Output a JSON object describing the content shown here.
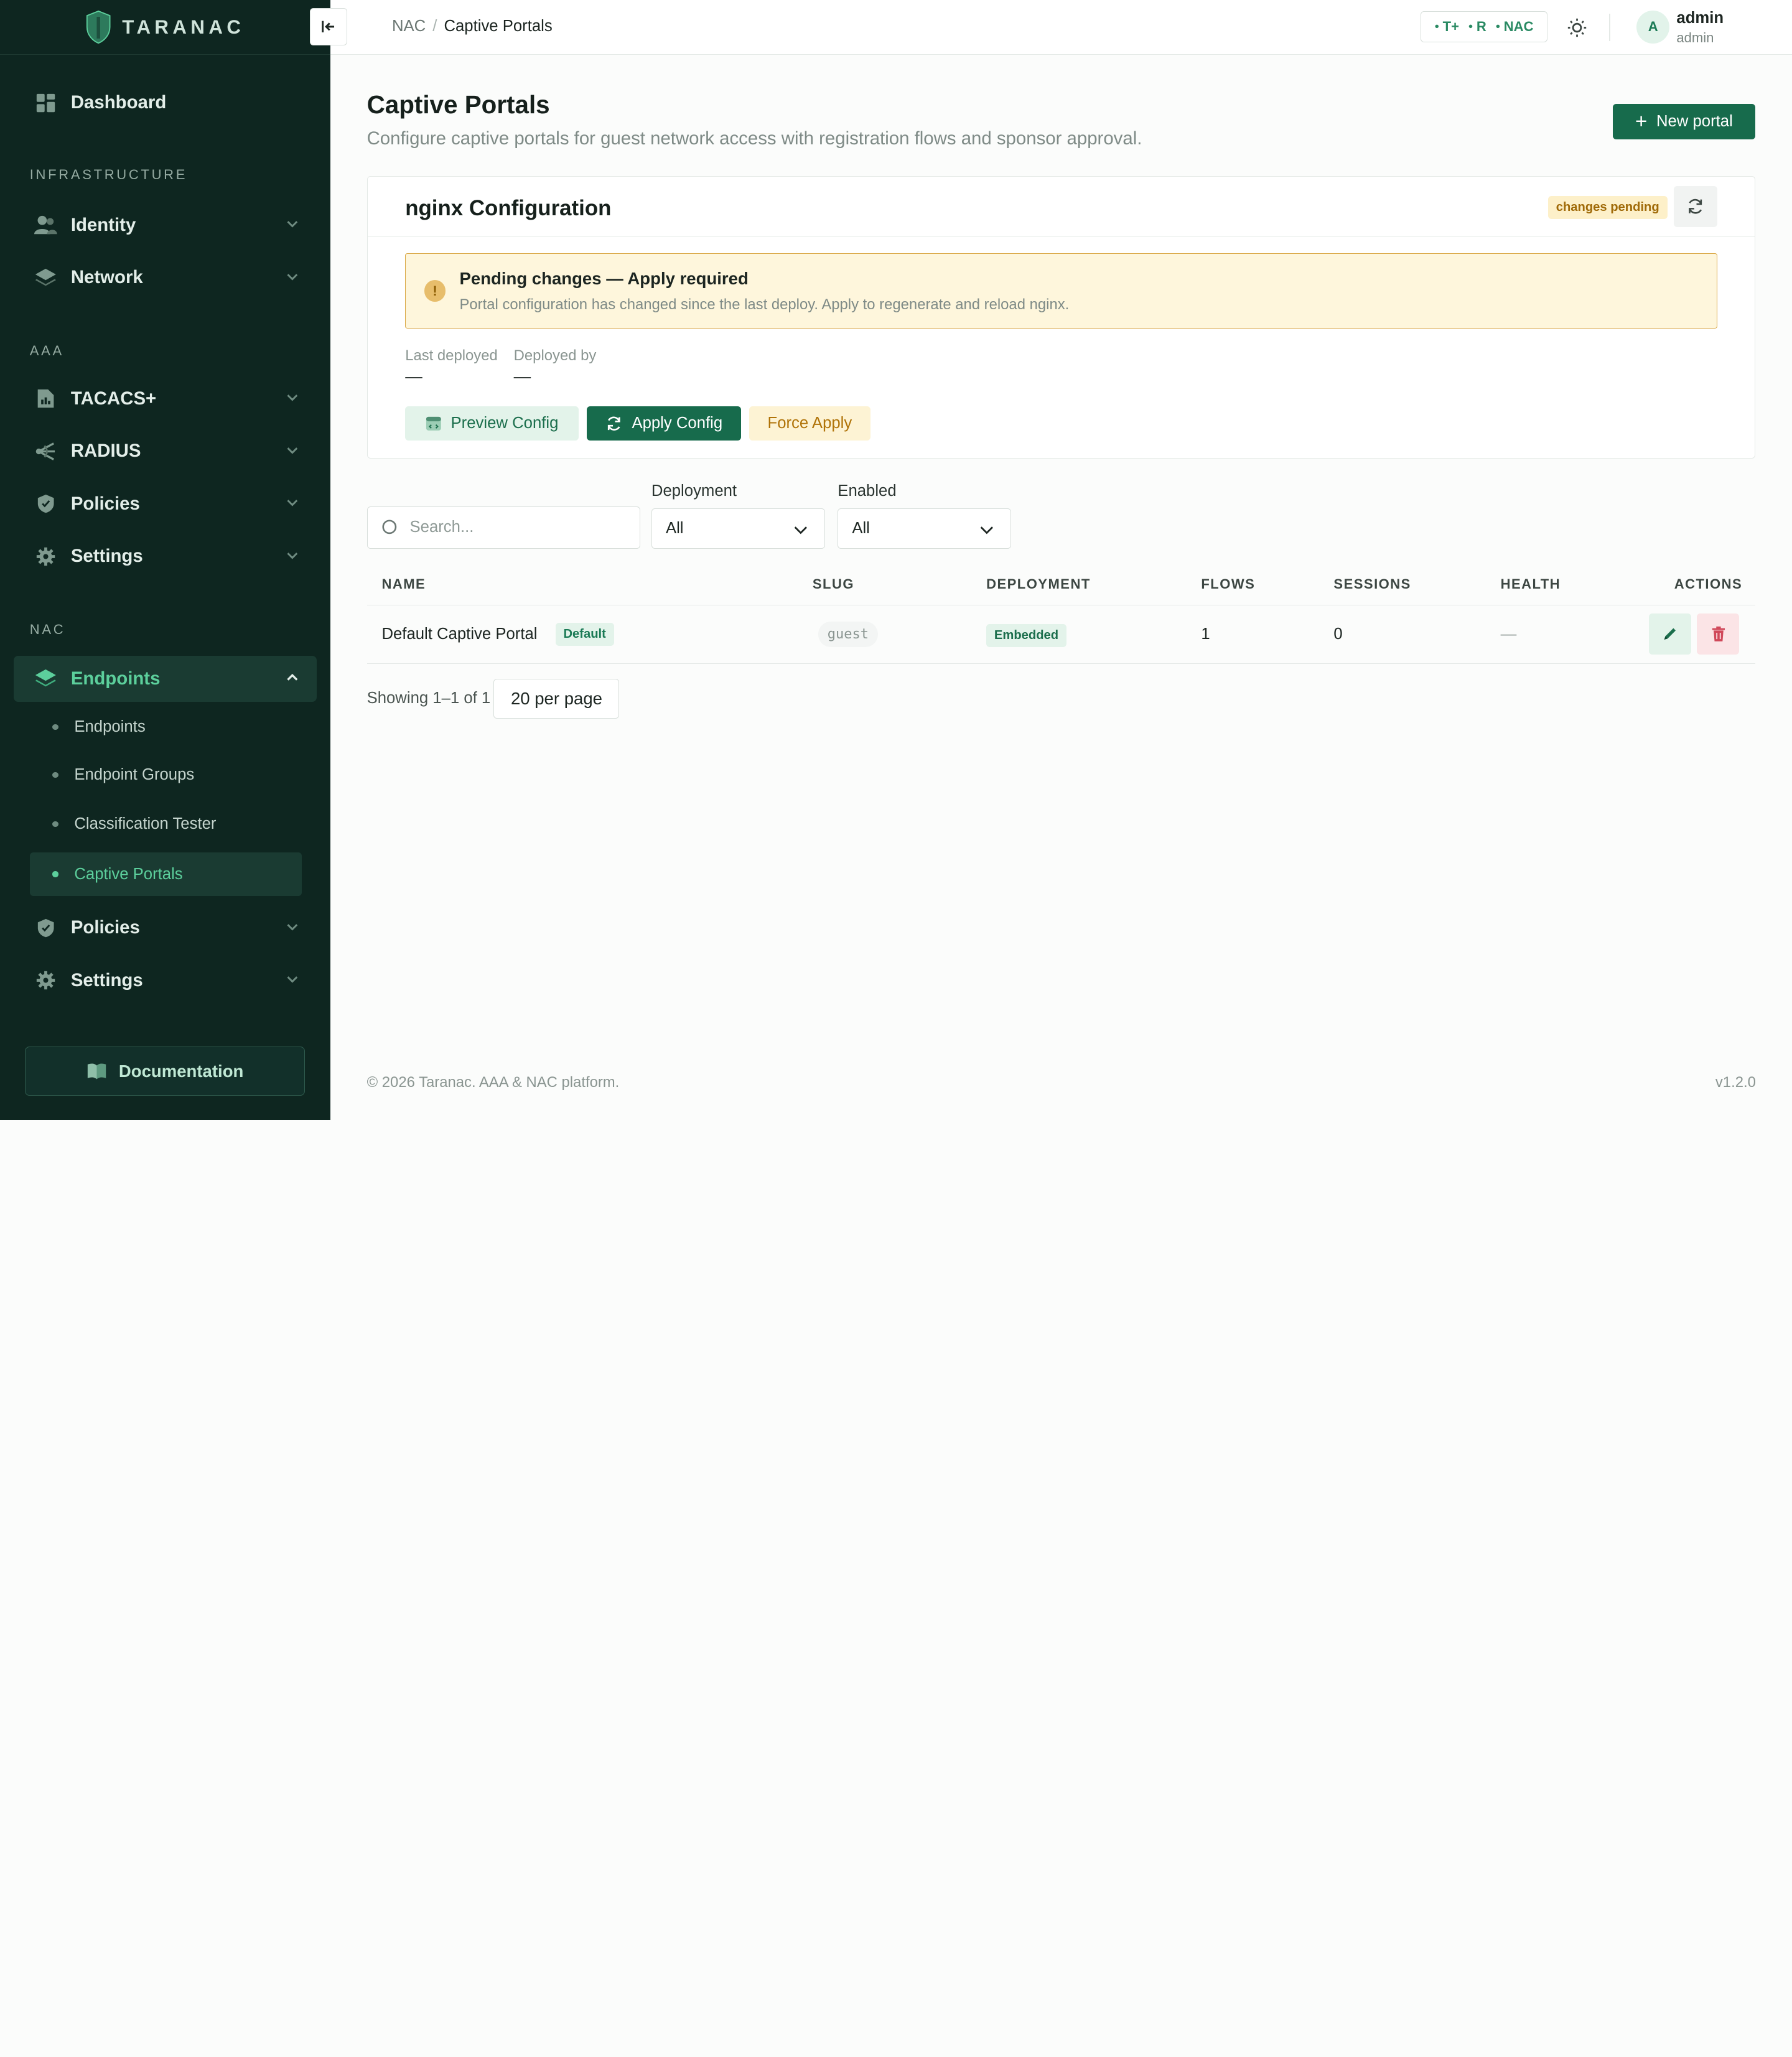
{
  "brand": {
    "name": "TARANAC"
  },
  "sidebar": {
    "dashboard": "Dashboard",
    "section_infrastructure": "INFRASTRUCTURE",
    "identity": "Identity",
    "network": "Network",
    "section_aaa": "AAA",
    "tacacs": "TACACS+",
    "radius": "RADIUS",
    "policies_aaa": "Policies",
    "settings_aaa": "Settings",
    "section_nac": "NAC",
    "endpoints": "Endpoints",
    "sub_items": [
      "Endpoints",
      "Endpoint Groups",
      "Classification Tester",
      "Captive Portals"
    ],
    "policies_nac": "Policies",
    "settings_nac": "Settings",
    "documentation": "Documentation"
  },
  "topbar": {
    "breadcrumb_root": "NAC",
    "breadcrumb_sep": "/",
    "breadcrumb_current": "Captive Portals",
    "status": [
      "T+",
      "R",
      "NAC"
    ],
    "avatar_initial": "A",
    "user_name": "admin",
    "user_role": "admin"
  },
  "page": {
    "title": "Captive Portals",
    "subtitle": "Configure captive portals for guest network access with registration flows and sponsor approval.",
    "new_button": "New portal"
  },
  "nginx": {
    "title": "nginx Configuration",
    "badge": "changes pending",
    "alert_icon": "!",
    "alert_title": "Pending changes — Apply required",
    "alert_text": "Portal configuration has changed since the last deploy. Apply to regenerate and reload nginx.",
    "last_deployed_label": "Last deployed",
    "last_deployed_value": "—",
    "deployed_by_label": "Deployed by",
    "deployed_by_value": "—",
    "preview_button": "Preview Config",
    "apply_button": "Apply Config",
    "force_button": "Force Apply"
  },
  "filters": {
    "search_placeholder": "Search...",
    "deployment_label": "Deployment",
    "deployment_value": "All",
    "enabled_label": "Enabled",
    "enabled_value": "All"
  },
  "table": {
    "headers": [
      "NAME",
      "SLUG",
      "DEPLOYMENT",
      "FLOWS",
      "SESSIONS",
      "HEALTH",
      "ACTIONS"
    ],
    "rows": [
      {
        "name": "Default Captive Portal",
        "badge": "Default",
        "slug": "guest",
        "deployment": "Embedded",
        "flows": "1",
        "sessions": "0",
        "health": "—"
      }
    ]
  },
  "pagination": {
    "showing": "Showing 1–1 of 1",
    "per_page": "20 per page"
  },
  "footer": {
    "copyright": "© 2026 Taranac. AAA & NAC platform.",
    "version": "v1.2.0"
  },
  "colors": {
    "sidebar_bg": "#0e2620",
    "accent": "#176b4c",
    "active_text": "#5ccf9c",
    "warning_bg": "#fef6dc",
    "warning_border": "#d9a642"
  }
}
